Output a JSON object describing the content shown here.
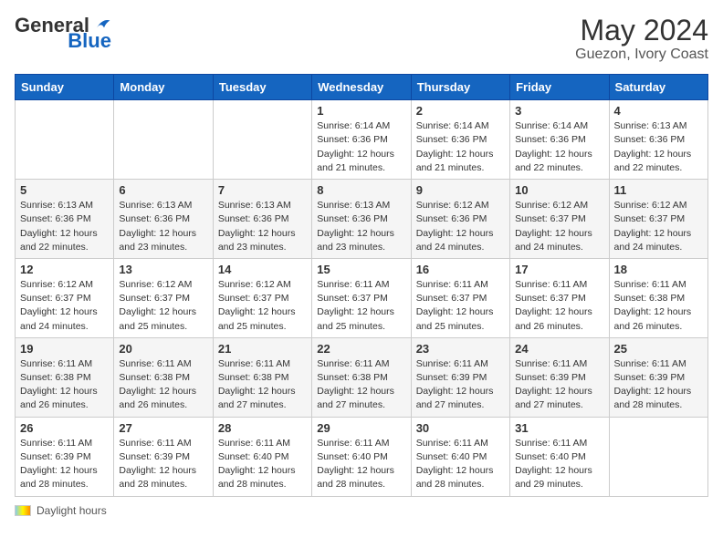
{
  "header": {
    "logo_general": "General",
    "logo_blue": "Blue",
    "month_year": "May 2024",
    "location": "Guezon, Ivory Coast"
  },
  "weekdays": [
    "Sunday",
    "Monday",
    "Tuesday",
    "Wednesday",
    "Thursday",
    "Friday",
    "Saturday"
  ],
  "weeks": [
    [
      {
        "day": "",
        "info": ""
      },
      {
        "day": "",
        "info": ""
      },
      {
        "day": "",
        "info": ""
      },
      {
        "day": "1",
        "info": "Sunrise: 6:14 AM\nSunset: 6:36 PM\nDaylight: 12 hours\nand 21 minutes."
      },
      {
        "day": "2",
        "info": "Sunrise: 6:14 AM\nSunset: 6:36 PM\nDaylight: 12 hours\nand 21 minutes."
      },
      {
        "day": "3",
        "info": "Sunrise: 6:14 AM\nSunset: 6:36 PM\nDaylight: 12 hours\nand 22 minutes."
      },
      {
        "day": "4",
        "info": "Sunrise: 6:13 AM\nSunset: 6:36 PM\nDaylight: 12 hours\nand 22 minutes."
      }
    ],
    [
      {
        "day": "5",
        "info": "Sunrise: 6:13 AM\nSunset: 6:36 PM\nDaylight: 12 hours\nand 22 minutes."
      },
      {
        "day": "6",
        "info": "Sunrise: 6:13 AM\nSunset: 6:36 PM\nDaylight: 12 hours\nand 23 minutes."
      },
      {
        "day": "7",
        "info": "Sunrise: 6:13 AM\nSunset: 6:36 PM\nDaylight: 12 hours\nand 23 minutes."
      },
      {
        "day": "8",
        "info": "Sunrise: 6:13 AM\nSunset: 6:36 PM\nDaylight: 12 hours\nand 23 minutes."
      },
      {
        "day": "9",
        "info": "Sunrise: 6:12 AM\nSunset: 6:36 PM\nDaylight: 12 hours\nand 24 minutes."
      },
      {
        "day": "10",
        "info": "Sunrise: 6:12 AM\nSunset: 6:37 PM\nDaylight: 12 hours\nand 24 minutes."
      },
      {
        "day": "11",
        "info": "Sunrise: 6:12 AM\nSunset: 6:37 PM\nDaylight: 12 hours\nand 24 minutes."
      }
    ],
    [
      {
        "day": "12",
        "info": "Sunrise: 6:12 AM\nSunset: 6:37 PM\nDaylight: 12 hours\nand 24 minutes."
      },
      {
        "day": "13",
        "info": "Sunrise: 6:12 AM\nSunset: 6:37 PM\nDaylight: 12 hours\nand 25 minutes."
      },
      {
        "day": "14",
        "info": "Sunrise: 6:12 AM\nSunset: 6:37 PM\nDaylight: 12 hours\nand 25 minutes."
      },
      {
        "day": "15",
        "info": "Sunrise: 6:11 AM\nSunset: 6:37 PM\nDaylight: 12 hours\nand 25 minutes."
      },
      {
        "day": "16",
        "info": "Sunrise: 6:11 AM\nSunset: 6:37 PM\nDaylight: 12 hours\nand 25 minutes."
      },
      {
        "day": "17",
        "info": "Sunrise: 6:11 AM\nSunset: 6:37 PM\nDaylight: 12 hours\nand 26 minutes."
      },
      {
        "day": "18",
        "info": "Sunrise: 6:11 AM\nSunset: 6:38 PM\nDaylight: 12 hours\nand 26 minutes."
      }
    ],
    [
      {
        "day": "19",
        "info": "Sunrise: 6:11 AM\nSunset: 6:38 PM\nDaylight: 12 hours\nand 26 minutes."
      },
      {
        "day": "20",
        "info": "Sunrise: 6:11 AM\nSunset: 6:38 PM\nDaylight: 12 hours\nand 26 minutes."
      },
      {
        "day": "21",
        "info": "Sunrise: 6:11 AM\nSunset: 6:38 PM\nDaylight: 12 hours\nand 27 minutes."
      },
      {
        "day": "22",
        "info": "Sunrise: 6:11 AM\nSunset: 6:38 PM\nDaylight: 12 hours\nand 27 minutes."
      },
      {
        "day": "23",
        "info": "Sunrise: 6:11 AM\nSunset: 6:39 PM\nDaylight: 12 hours\nand 27 minutes."
      },
      {
        "day": "24",
        "info": "Sunrise: 6:11 AM\nSunset: 6:39 PM\nDaylight: 12 hours\nand 27 minutes."
      },
      {
        "day": "25",
        "info": "Sunrise: 6:11 AM\nSunset: 6:39 PM\nDaylight: 12 hours\nand 28 minutes."
      }
    ],
    [
      {
        "day": "26",
        "info": "Sunrise: 6:11 AM\nSunset: 6:39 PM\nDaylight: 12 hours\nand 28 minutes."
      },
      {
        "day": "27",
        "info": "Sunrise: 6:11 AM\nSunset: 6:39 PM\nDaylight: 12 hours\nand 28 minutes."
      },
      {
        "day": "28",
        "info": "Sunrise: 6:11 AM\nSunset: 6:40 PM\nDaylight: 12 hours\nand 28 minutes."
      },
      {
        "day": "29",
        "info": "Sunrise: 6:11 AM\nSunset: 6:40 PM\nDaylight: 12 hours\nand 28 minutes."
      },
      {
        "day": "30",
        "info": "Sunrise: 6:11 AM\nSunset: 6:40 PM\nDaylight: 12 hours\nand 28 minutes."
      },
      {
        "day": "31",
        "info": "Sunrise: 6:11 AM\nSunset: 6:40 PM\nDaylight: 12 hours\nand 29 minutes."
      },
      {
        "day": "",
        "info": ""
      }
    ]
  ],
  "footer": {
    "daylight_hours_label": "Daylight hours"
  }
}
